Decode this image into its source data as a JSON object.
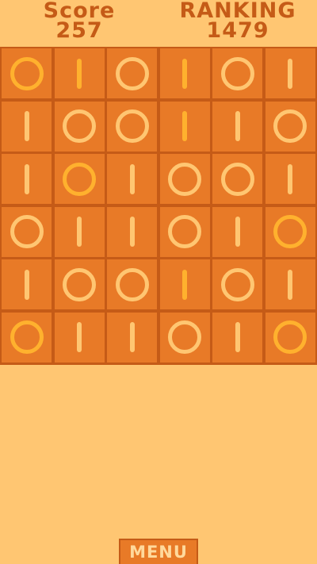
{
  "hud": {
    "score_label": "Score",
    "score_value": "257",
    "ranking_label": "RANKING",
    "ranking_value": "1479"
  },
  "board": {
    "rows": 6,
    "cols": 6,
    "cells": [
      [
        "O",
        "I",
        "O",
        "I",
        "O",
        "I"
      ],
      [
        "I",
        "O",
        "O",
        "I",
        "I",
        "O"
      ],
      [
        "I",
        "O",
        "I",
        "O",
        "O",
        "I"
      ],
      [
        "O",
        "I",
        "I",
        "O",
        "I",
        "O"
      ],
      [
        "I",
        "O",
        "O",
        "I",
        "O",
        "I"
      ],
      [
        "O",
        "I",
        "I",
        "O",
        "I",
        "O"
      ]
    ],
    "highlighted": [
      [
        true,
        true,
        false,
        true,
        false,
        false
      ],
      [
        false,
        false,
        false,
        true,
        false,
        false
      ],
      [
        false,
        true,
        false,
        false,
        false,
        false
      ],
      [
        false,
        false,
        false,
        false,
        false,
        true
      ],
      [
        false,
        false,
        false,
        true,
        false,
        false
      ],
      [
        true,
        false,
        false,
        false,
        false,
        true
      ]
    ]
  },
  "menu": {
    "label": "MENU"
  },
  "colors": {
    "background": "#ffc672",
    "tile": "#e87a27",
    "grid": "#c55b17",
    "symbol": "#ffc672",
    "symbol_highlight": "#ffb12e",
    "text": "#c55b17"
  }
}
